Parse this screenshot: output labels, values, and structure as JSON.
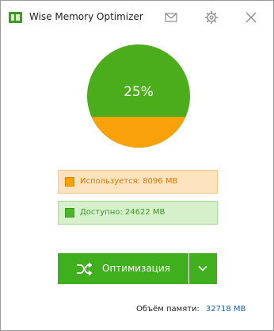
{
  "window": {
    "title": "Wise Memory Optimizer",
    "icons": [
      "app-icon",
      "mail-icon",
      "gear-icon",
      "close-icon"
    ]
  },
  "usage": {
    "percent_label": "25%",
    "used_fraction": 0.25,
    "colors": {
      "free": "#4bad1c",
      "used": "#f8a10a"
    }
  },
  "memory": {
    "used_text": "Используется: 8096 MB",
    "free_text": "Доступно: 24622 MB",
    "total_label": "Объём памяти:",
    "total_value": "32718 MB"
  },
  "actions": {
    "optimize_label": "Оптимизация",
    "optimize_icon": "shuffle-icon",
    "dropdown_icon": "chevron-down-icon"
  },
  "colors": {
    "accent_green": "#3faf1e",
    "used_orange": "#f6a108",
    "link_blue": "#1f5fa6"
  }
}
